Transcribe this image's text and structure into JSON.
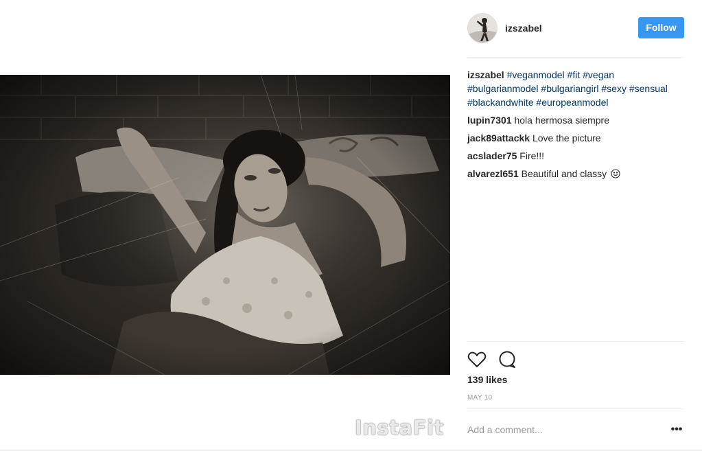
{
  "post": {
    "author": "izszabel",
    "follow_label": "Follow",
    "caption_tags": [
      "#veganmodel",
      "#fit",
      "#vegan",
      "#bulgarianmodel",
      "#bulgariangirl",
      "#sexy",
      "#sensual",
      "#blackandwhite",
      "#europeanmodel"
    ],
    "likes": "139 likes",
    "date": "MAY 10",
    "comment_placeholder": "Add a comment...",
    "more_label": "•••",
    "watermark": "InstaFit"
  },
  "comments": [
    {
      "user": "lupin7301",
      "text": "hola hermosa siempre"
    },
    {
      "user": "jack89attackk",
      "text": "Love the picture"
    },
    {
      "user": "acslader75",
      "text": "Fire!!!"
    },
    {
      "user": "alvarezl651",
      "text": "Beautiful and classy",
      "emoji": "smiley-face-icon"
    }
  ],
  "icons": {
    "like": "heart-icon",
    "comment": "speech-bubble-icon",
    "more": "ellipsis-icon"
  },
  "colors": {
    "follow_button": "#3897f0",
    "hashtag": "#003569",
    "secondary_text": "#999999"
  }
}
